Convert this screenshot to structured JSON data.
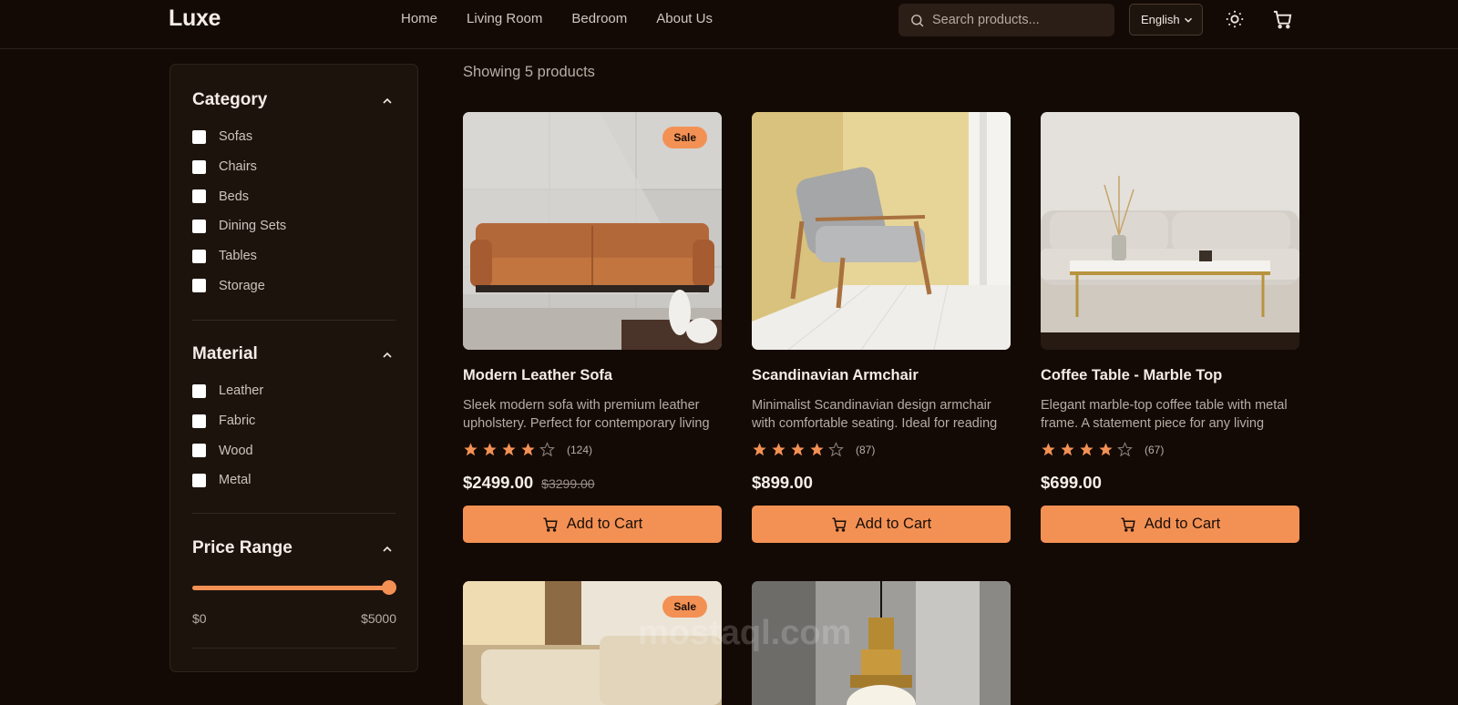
{
  "brand": {
    "logo": "Luxe",
    "accent": "#f39155",
    "background": "#140a05"
  },
  "nav": [
    {
      "label": "Home"
    },
    {
      "label": "Living Room"
    },
    {
      "label": "Bedroom"
    },
    {
      "label": "About Us"
    }
  ],
  "search": {
    "placeholder": "Search products...",
    "icon": "search-icon"
  },
  "language": {
    "selected": "English",
    "icon": "chevron-down-icon"
  },
  "header_icons": [
    "sun-icon",
    "cart-icon"
  ],
  "filters": {
    "category": {
      "title": "Category",
      "options": [
        "Sofas",
        "Chairs",
        "Beds",
        "Dining Sets",
        "Tables",
        "Storage"
      ]
    },
    "material": {
      "title": "Material",
      "options": [
        "Leather",
        "Fabric",
        "Wood",
        "Metal"
      ]
    },
    "price": {
      "title": "Price Range",
      "min_label": "$0",
      "max_label": "$5000",
      "value_fraction": 1.0
    }
  },
  "results": {
    "summary": "Showing 5 products"
  },
  "products": [
    {
      "name": "Modern Leather Sofa",
      "description": "Sleek modern sofa with premium leather upholstery. Perfect for contemporary living spaces.",
      "rating": 4,
      "reviews": "(124)",
      "price": "$2499.00",
      "old_price": "$3299.00",
      "badge": "Sale",
      "cta": "Add to Cart"
    },
    {
      "name": "Scandinavian Armchair",
      "description": "Minimalist Scandinavian design armchair with comfortable seating. Ideal for reading corners.",
      "rating": 4,
      "reviews": "(87)",
      "price": "$899.00",
      "old_price": "",
      "badge": "",
      "cta": "Add to Cart"
    },
    {
      "name": "Coffee Table - Marble Top",
      "description": "Elegant marble-top coffee table with metal frame. A statement piece for any living room.",
      "rating": 4,
      "reviews": "(67)",
      "price": "$699.00",
      "old_price": "",
      "badge": "",
      "cta": "Add to Cart"
    },
    {
      "badge": "Sale"
    },
    {
      "badge": ""
    }
  ],
  "watermark": "mostaql.com"
}
